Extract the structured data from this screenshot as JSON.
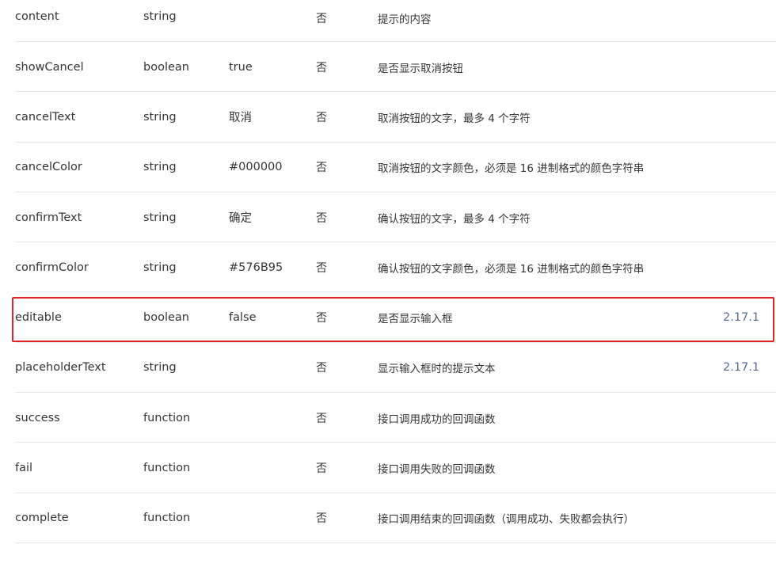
{
  "rows": [
    {
      "name": "content",
      "type": "string",
      "default": "",
      "required": "否",
      "desc": "提示的内容",
      "version": ""
    },
    {
      "name": "showCancel",
      "type": "boolean",
      "default": "true",
      "required": "否",
      "desc": "是否显示取消按钮",
      "version": ""
    },
    {
      "name": "cancelText",
      "type": "string",
      "default": "取消",
      "required": "否",
      "desc": "取消按钮的文字，最多 4 个字符",
      "version": ""
    },
    {
      "name": "cancelColor",
      "type": "string",
      "default": "#000000",
      "required": "否",
      "desc": "取消按钮的文字颜色，必须是 16 进制格式的颜色字符串",
      "version": ""
    },
    {
      "name": "confirmText",
      "type": "string",
      "default": "确定",
      "required": "否",
      "desc": "确认按钮的文字，最多 4 个字符",
      "version": ""
    },
    {
      "name": "confirmColor",
      "type": "string",
      "default": "#576B95",
      "required": "否",
      "desc": "确认按钮的文字颜色，必须是 16 进制格式的颜色字符串",
      "version": ""
    },
    {
      "name": "editable",
      "type": "boolean",
      "default": "false",
      "required": "否",
      "desc": "是否显示输入框",
      "version": "2.17.1"
    },
    {
      "name": "placeholderText",
      "type": "string",
      "default": "",
      "required": "否",
      "desc": "显示输入框时的提示文本",
      "version": "2.17.1"
    },
    {
      "name": "success",
      "type": "function",
      "default": "",
      "required": "否",
      "desc": "接口调用成功的回调函数",
      "version": ""
    },
    {
      "name": "fail",
      "type": "function",
      "default": "",
      "required": "否",
      "desc": "接口调用失败的回调函数",
      "version": ""
    },
    {
      "name": "complete",
      "type": "function",
      "default": "",
      "required": "否",
      "desc": "接口调用结束的回调函数（调用成功、失败都会执行）",
      "version": ""
    }
  ],
  "colors": {
    "text": "#353535",
    "version_link": "#576b95",
    "highlight_border": "#e02424",
    "divider": "#e8e8e8"
  }
}
